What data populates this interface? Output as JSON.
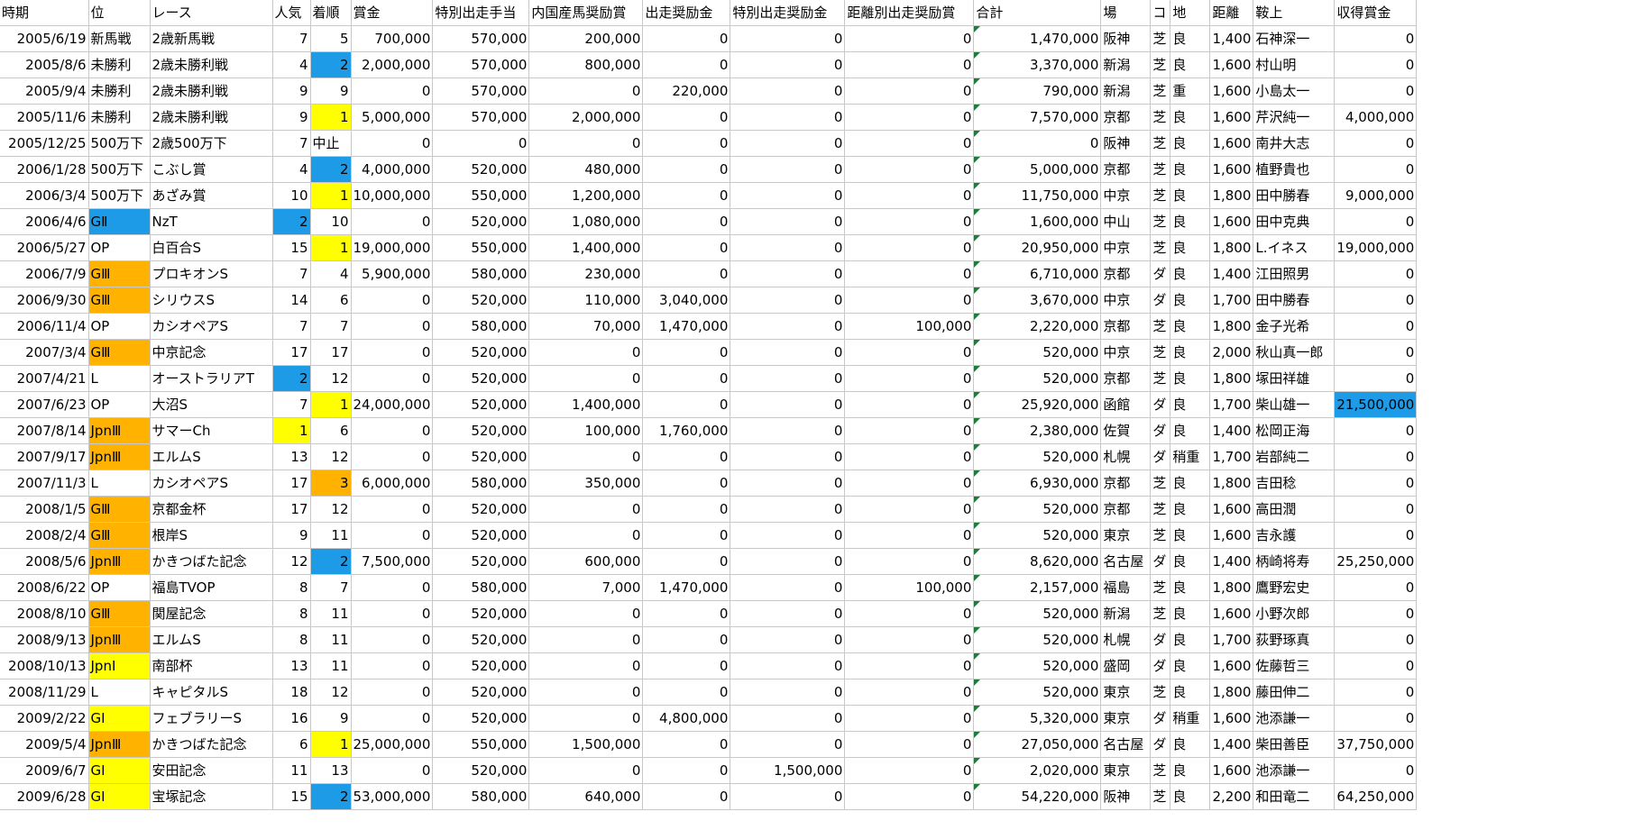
{
  "colors": {
    "yellow": "#FFFF00",
    "orange": "#FFB300",
    "blue": "#1E9BE6"
  },
  "columns": [
    "時期",
    "位",
    "レース",
    "人気",
    "着順",
    "賞金",
    "特別出走手当",
    "内国産馬奨励賞",
    "出走奨励金",
    "特別出走奨励金",
    "距離別出走奨励賞",
    "合計",
    "場",
    "コ",
    "地",
    "距離",
    "鞍上",
    "収得賞金"
  ],
  "rows": [
    {
      "cells": [
        "2005/6/19",
        "新馬戦",
        "2歳新馬戦",
        "7",
        "5",
        "700,000",
        "570,000",
        "200,000",
        "0",
        "0",
        "0",
        "1,470,000",
        "阪神",
        "芝",
        "良",
        "1,400",
        "石神深一",
        "0"
      ],
      "fills": {}
    },
    {
      "cells": [
        "2005/8/6",
        "未勝利",
        "2歳未勝利戦",
        "4",
        "2",
        "2,000,000",
        "570,000",
        "800,000",
        "0",
        "0",
        "0",
        "3,370,000",
        "新潟",
        "芝",
        "良",
        "1,600",
        "村山明",
        "0"
      ],
      "fills": {
        "4": "blue"
      }
    },
    {
      "cells": [
        "2005/9/4",
        "未勝利",
        "2歳未勝利戦",
        "9",
        "9",
        "0",
        "570,000",
        "0",
        "220,000",
        "0",
        "0",
        "790,000",
        "新潟",
        "芝",
        "重",
        "1,600",
        "小島太一",
        "0"
      ],
      "fills": {}
    },
    {
      "cells": [
        "2005/11/6",
        "未勝利",
        "2歳未勝利戦",
        "9",
        "1",
        "5,000,000",
        "570,000",
        "2,000,000",
        "0",
        "0",
        "0",
        "7,570,000",
        "京都",
        "芝",
        "良",
        "1,600",
        "芹沢純一",
        "4,000,000"
      ],
      "fills": {
        "4": "yellow"
      }
    },
    {
      "cells": [
        "2005/12/25",
        "500万下",
        "2歳500万下",
        "7",
        "中止",
        "0",
        "0",
        "0",
        "0",
        "0",
        "0",
        "0",
        "阪神",
        "芝",
        "良",
        "1,600",
        "南井大志",
        "0"
      ],
      "fills": {}
    },
    {
      "cells": [
        "2006/1/28",
        "500万下",
        "こぶし賞",
        "4",
        "2",
        "4,000,000",
        "520,000",
        "480,000",
        "0",
        "0",
        "0",
        "5,000,000",
        "京都",
        "芝",
        "良",
        "1,600",
        "植野貴也",
        "0"
      ],
      "fills": {
        "4": "blue"
      }
    },
    {
      "cells": [
        "2006/3/4",
        "500万下",
        "あざみ賞",
        "10",
        "1",
        "10,000,000",
        "550,000",
        "1,200,000",
        "0",
        "0",
        "0",
        "11,750,000",
        "中京",
        "芝",
        "良",
        "1,800",
        "田中勝春",
        "9,000,000"
      ],
      "fills": {
        "4": "yellow"
      }
    },
    {
      "cells": [
        "2006/4/6",
        "GⅡ",
        "NzT",
        "2",
        "10",
        "0",
        "520,000",
        "1,080,000",
        "0",
        "0",
        "0",
        "1,600,000",
        "中山",
        "芝",
        "良",
        "1,600",
        "田中克典",
        "0"
      ],
      "fills": {
        "1": "blue",
        "3": "blue"
      }
    },
    {
      "cells": [
        "2006/5/27",
        "OP",
        "白百合S",
        "15",
        "1",
        "19,000,000",
        "550,000",
        "1,400,000",
        "0",
        "0",
        "0",
        "20,950,000",
        "中京",
        "芝",
        "良",
        "1,800",
        "L.イネス",
        "19,000,000"
      ],
      "fills": {
        "4": "yellow"
      }
    },
    {
      "cells": [
        "2006/7/9",
        "GⅢ",
        "プロキオンS",
        "7",
        "4",
        "5,900,000",
        "580,000",
        "230,000",
        "0",
        "0",
        "0",
        "6,710,000",
        "京都",
        "ダ",
        "良",
        "1,400",
        "江田照男",
        "0"
      ],
      "fills": {
        "1": "orange"
      }
    },
    {
      "cells": [
        "2006/9/30",
        "GⅢ",
        "シリウスS",
        "14",
        "6",
        "0",
        "520,000",
        "110,000",
        "3,040,000",
        "0",
        "0",
        "3,670,000",
        "中京",
        "ダ",
        "良",
        "1,700",
        "田中勝春",
        "0"
      ],
      "fills": {
        "1": "orange"
      }
    },
    {
      "cells": [
        "2006/11/4",
        "OP",
        "カシオペアS",
        "7",
        "7",
        "0",
        "580,000",
        "70,000",
        "1,470,000",
        "0",
        "100,000",
        "2,220,000",
        "京都",
        "芝",
        "良",
        "1,800",
        "金子光希",
        "0"
      ],
      "fills": {}
    },
    {
      "cells": [
        "2007/3/4",
        "GⅢ",
        "中京記念",
        "17",
        "17",
        "0",
        "520,000",
        "0",
        "0",
        "0",
        "0",
        "520,000",
        "中京",
        "芝",
        "良",
        "2,000",
        "秋山真一郎",
        "0"
      ],
      "fills": {
        "1": "orange"
      }
    },
    {
      "cells": [
        "2007/4/21",
        "L",
        "オーストラリアT",
        "2",
        "12",
        "0",
        "520,000",
        "0",
        "0",
        "0",
        "0",
        "520,000",
        "京都",
        "芝",
        "良",
        "1,800",
        "塚田祥雄",
        "0"
      ],
      "fills": {
        "3": "blue"
      }
    },
    {
      "cells": [
        "2007/6/23",
        "OP",
        "大沼S",
        "7",
        "1",
        "24,000,000",
        "520,000",
        "1,400,000",
        "0",
        "0",
        "0",
        "25,920,000",
        "函館",
        "ダ",
        "良",
        "1,700",
        "柴山雄一",
        "21,500,000"
      ],
      "fills": {
        "4": "yellow",
        "17": "blue"
      }
    },
    {
      "cells": [
        "2007/8/14",
        "JpnⅢ",
        "サマーCh",
        "1",
        "6",
        "0",
        "520,000",
        "100,000",
        "1,760,000",
        "0",
        "0",
        "2,380,000",
        "佐賀",
        "ダ",
        "良",
        "1,400",
        "松岡正海",
        "0"
      ],
      "fills": {
        "1": "orange",
        "3": "yellow"
      }
    },
    {
      "cells": [
        "2007/9/17",
        "JpnⅢ",
        "エルムS",
        "13",
        "12",
        "0",
        "520,000",
        "0",
        "0",
        "0",
        "0",
        "520,000",
        "札幌",
        "ダ",
        "稍重",
        "1,700",
        "岩部純二",
        "0"
      ],
      "fills": {
        "1": "orange"
      }
    },
    {
      "cells": [
        "2007/11/3",
        "L",
        "カシオペアS",
        "17",
        "3",
        "6,000,000",
        "580,000",
        "350,000",
        "0",
        "0",
        "0",
        "6,930,000",
        "京都",
        "芝",
        "良",
        "1,800",
        "吉田稔",
        "0"
      ],
      "fills": {
        "4": "orange"
      }
    },
    {
      "cells": [
        "2008/1/5",
        "GⅢ",
        "京都金杯",
        "17",
        "12",
        "0",
        "520,000",
        "0",
        "0",
        "0",
        "0",
        "520,000",
        "京都",
        "芝",
        "良",
        "1,600",
        "高田潤",
        "0"
      ],
      "fills": {
        "1": "orange"
      }
    },
    {
      "cells": [
        "2008/2/4",
        "GⅢ",
        "根岸S",
        "9",
        "11",
        "0",
        "520,000",
        "0",
        "0",
        "0",
        "0",
        "520,000",
        "東京",
        "芝",
        "良",
        "1,600",
        "吉永護",
        "0"
      ],
      "fills": {
        "1": "orange"
      }
    },
    {
      "cells": [
        "2008/5/6",
        "JpnⅢ",
        "かきつばた記念",
        "12",
        "2",
        "7,500,000",
        "520,000",
        "600,000",
        "0",
        "0",
        "0",
        "8,620,000",
        "名古屋",
        "ダ",
        "良",
        "1,400",
        "柄崎将寿",
        "25,250,000"
      ],
      "fills": {
        "1": "orange",
        "4": "blue"
      }
    },
    {
      "cells": [
        "2008/6/22",
        "OP",
        "福島TVOP",
        "8",
        "7",
        "0",
        "580,000",
        "7,000",
        "1,470,000",
        "0",
        "100,000",
        "2,157,000",
        "福島",
        "芝",
        "良",
        "1,800",
        "鷹野宏史",
        "0"
      ],
      "fills": {}
    },
    {
      "cells": [
        "2008/8/10",
        "GⅢ",
        "関屋記念",
        "8",
        "11",
        "0",
        "520,000",
        "0",
        "0",
        "0",
        "0",
        "520,000",
        "新潟",
        "芝",
        "良",
        "1,600",
        "小野次郎",
        "0"
      ],
      "fills": {
        "1": "orange"
      }
    },
    {
      "cells": [
        "2008/9/13",
        "JpnⅢ",
        "エルムS",
        "8",
        "11",
        "0",
        "520,000",
        "0",
        "0",
        "0",
        "0",
        "520,000",
        "札幌",
        "ダ",
        "良",
        "1,700",
        "荻野琢真",
        "0"
      ],
      "fills": {
        "1": "orange"
      }
    },
    {
      "cells": [
        "2008/10/13",
        "JpnⅠ",
        "南部杯",
        "13",
        "11",
        "0",
        "520,000",
        "0",
        "0",
        "0",
        "0",
        "520,000",
        "盛岡",
        "ダ",
        "良",
        "1,600",
        "佐藤哲三",
        "0"
      ],
      "fills": {
        "1": "yellow"
      }
    },
    {
      "cells": [
        "2008/11/29",
        "L",
        "キャピタルS",
        "18",
        "12",
        "0",
        "520,000",
        "0",
        "0",
        "0",
        "0",
        "520,000",
        "東京",
        "芝",
        "良",
        "1,800",
        "藤田伸二",
        "0"
      ],
      "fills": {}
    },
    {
      "cells": [
        "2009/2/22",
        "GⅠ",
        "フェブラリーS",
        "16",
        "9",
        "0",
        "520,000",
        "0",
        "4,800,000",
        "0",
        "0",
        "5,320,000",
        "東京",
        "ダ",
        "稍重",
        "1,600",
        "池添謙一",
        "0"
      ],
      "fills": {
        "1": "yellow"
      }
    },
    {
      "cells": [
        "2009/5/4",
        "JpnⅢ",
        "かきつばた記念",
        "6",
        "1",
        "25,000,000",
        "550,000",
        "1,500,000",
        "0",
        "0",
        "0",
        "27,050,000",
        "名古屋",
        "ダ",
        "良",
        "1,400",
        "柴田善臣",
        "37,750,000"
      ],
      "fills": {
        "1": "orange",
        "4": "yellow"
      }
    },
    {
      "cells": [
        "2009/6/7",
        "GⅠ",
        "安田記念",
        "11",
        "13",
        "0",
        "520,000",
        "0",
        "0",
        "1,500,000",
        "0",
        "2,020,000",
        "東京",
        "芝",
        "良",
        "1,600",
        "池添謙一",
        "0"
      ],
      "fills": {
        "1": "yellow"
      }
    },
    {
      "cells": [
        "2009/6/28",
        "GⅠ",
        "宝塚記念",
        "15",
        "2",
        "53,000,000",
        "580,000",
        "640,000",
        "0",
        "0",
        "0",
        "54,220,000",
        "阪神",
        "芝",
        "良",
        "2,200",
        "和田竜二",
        "64,250,000"
      ],
      "fills": {
        "1": "yellow",
        "4": "blue"
      }
    }
  ]
}
